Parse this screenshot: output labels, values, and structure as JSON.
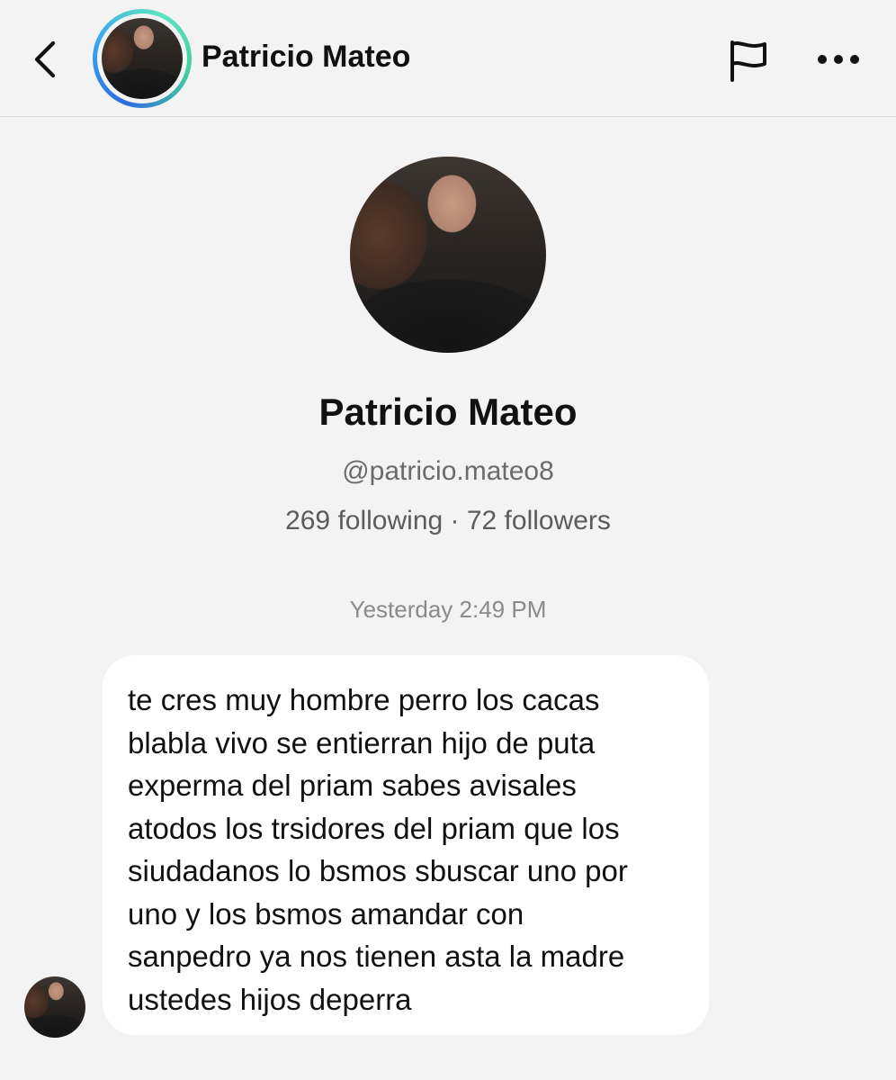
{
  "header": {
    "back_icon": "chevron-left-icon",
    "name": "Patricio Mateo",
    "flag_icon": "flag-icon",
    "more_icon": "ellipsis-horizontal-icon",
    "avatar_ring_colors": [
      "#2f6be0",
      "#3aa6ef",
      "#5fe3c2"
    ]
  },
  "profile": {
    "name": "Patricio Mateo",
    "handle": "@patricio.mateo8",
    "stats": "269 following · 72 followers"
  },
  "conversation": {
    "timestamp": "Yesterday 2:49 PM",
    "messages": [
      {
        "lines": [
          "te cres muy hombre perro los cacas",
          "blabla vivo se entierran hijo de puta",
          "experma del priam sabes avisales",
          "atodos los trsidores del priam que los",
          "siudadanos lo bsmos sbuscar uno por",
          "uno y los bsmos amandar con",
          "sanpedro ya nos tienen asta la madre",
          "ustedes hijos deperra"
        ]
      }
    ]
  },
  "colors": {
    "background": "#f3f3f3",
    "bubble": "#ffffff",
    "secondary_text": "#6b6b6b",
    "timestamp_text": "#8a8a8a"
  }
}
